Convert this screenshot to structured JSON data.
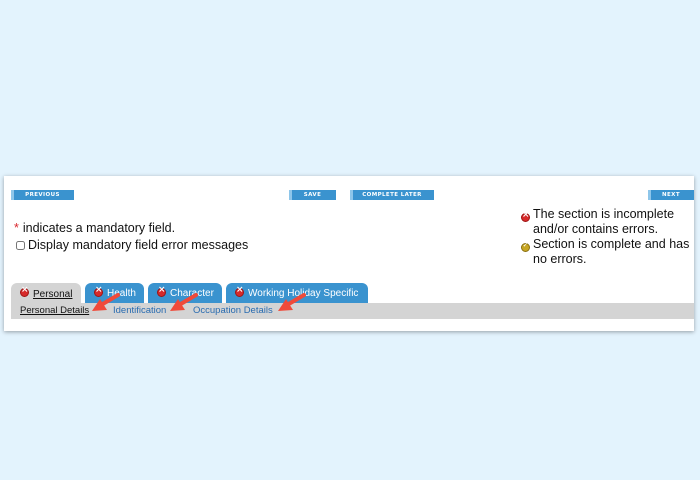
{
  "toolbar": {
    "previous_label": "PREVIOUS",
    "save_label": "SAVE",
    "complete_later_label": "COMPLETE LATER",
    "next_label": "NEXT"
  },
  "form": {
    "mandatory_asterisk": "*",
    "mandatory_note": "indicates a mandatory field.",
    "error_toggle_label": "Display mandatory field error messages",
    "error_toggle_checked": false
  },
  "legend": {
    "incomplete": "The section is incomplete and/or contains errors.",
    "complete": "Section is complete and has no errors."
  },
  "tabs": [
    {
      "label": "Personal",
      "status": "error",
      "active": true
    },
    {
      "label": "Health",
      "status": "error",
      "active": false
    },
    {
      "label": "Character",
      "status": "error",
      "active": false
    },
    {
      "label": "Working Holiday Specific",
      "status": "error",
      "active": false
    }
  ],
  "subtabs": [
    {
      "label": "Personal Details",
      "active": true
    },
    {
      "label": "Identification",
      "active": false
    },
    {
      "label": "Occupation Details",
      "active": false
    }
  ],
  "colors": {
    "page_background": "#e3f3fd",
    "button_blue": "#3a93cf",
    "error_red": "#d72a2a",
    "complete_gold": "#c7a623",
    "annotation_arrow": "#f04a3a"
  }
}
